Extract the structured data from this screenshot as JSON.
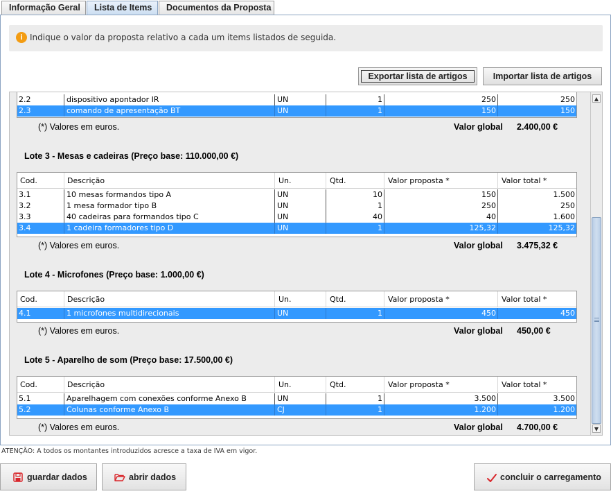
{
  "tabs": [
    {
      "label": "Informação Geral",
      "active": false
    },
    {
      "label": "Lista de Items",
      "active": true
    },
    {
      "label": "Documentos da Proposta",
      "active": false
    }
  ],
  "info_message": "Indique o valor da proposta relativo a cada um items listados de seguida.",
  "toolbar": {
    "export_label": "Exportar lista de artigos",
    "import_label": "Importar lista de artigos"
  },
  "columns": [
    "Cod.",
    "Descrição",
    "Un.",
    "Qtd.",
    "Valor proposta *",
    "Valor total *"
  ],
  "note": "(*) Valores em euros.",
  "global_label": "Valor global",
  "lote2_partial": {
    "rows": [
      {
        "cod": "2.2",
        "desc": "dispositivo apontador IR",
        "un": "UN",
        "qtd": "1",
        "valor": "250",
        "total": "250",
        "selected": false
      },
      {
        "cod": "2.3",
        "desc": "comando de apresentação BT",
        "un": "UN",
        "qtd": "1",
        "valor": "150",
        "total": "150",
        "selected": true
      }
    ],
    "global_value": "2.400,00 €"
  },
  "lotes": [
    {
      "title": "Lote  3 - Mesas e cadeiras (Preço base:  110.000,00 €)",
      "rows": [
        {
          "cod": "3.1",
          "desc": "10 mesas formandos tipo A",
          "un": "UN",
          "qtd": "10",
          "valor": "150",
          "total": "1.500",
          "selected": false
        },
        {
          "cod": "3.2",
          "desc": "1 mesa formador tipo B",
          "un": "UN",
          "qtd": "1",
          "valor": "250",
          "total": "250",
          "selected": false
        },
        {
          "cod": "3.3",
          "desc": "40 cadeiras para formandos tipo C",
          "un": "UN",
          "qtd": "40",
          "valor": "40",
          "total": "1.600",
          "selected": false
        },
        {
          "cod": "3.4",
          "desc": "1 cadeira formadores tipo D",
          "un": "UN",
          "qtd": "1",
          "valor": "125,32",
          "total": "125,32",
          "selected": true
        }
      ],
      "global_value": "3.475,32 €"
    },
    {
      "title": "Lote  4 - Microfones (Preço base:  1.000,00 €)",
      "rows": [
        {
          "cod": "4.1",
          "desc": "1 microfones multidirecionais",
          "un": "UN",
          "qtd": "1",
          "valor": "450",
          "total": "450",
          "selected": true
        }
      ],
      "global_value": "450,00 €"
    },
    {
      "title": "Lote  5 - Aparelho de som (Preço base:  17.500,00 €)",
      "rows": [
        {
          "cod": "5.1",
          "desc": "Aparelhagem com conexões conforme Anexo B",
          "un": "UN",
          "qtd": "1",
          "valor": "3.500",
          "total": "3.500",
          "selected": false
        },
        {
          "cod": "5.2",
          "desc": "Colunas conforme Anexo B",
          "un": "CJ",
          "qtd": "1",
          "valor": "1.200",
          "total": "1.200",
          "selected": true
        }
      ],
      "global_value": "4.700,00 €"
    }
  ],
  "warning": "ATENÇÃO: A todos os montantes introduzidos acresce a taxa de IVA em vigor.",
  "footer": {
    "save_label": "guardar dados",
    "open_label": "abrir dados",
    "finish_label": "concluir o carregamento"
  },
  "icons": {
    "info": "info-icon",
    "save": "floppy-disk-icon",
    "open": "folder-open-icon",
    "finish": "check-mark-icon",
    "scroll_up": "arrow-up-icon",
    "scroll_down": "arrow-down-icon"
  },
  "colors": {
    "selection": "#3399ff",
    "info_icon": "#f39c12",
    "icon_red": "#d9262b"
  }
}
